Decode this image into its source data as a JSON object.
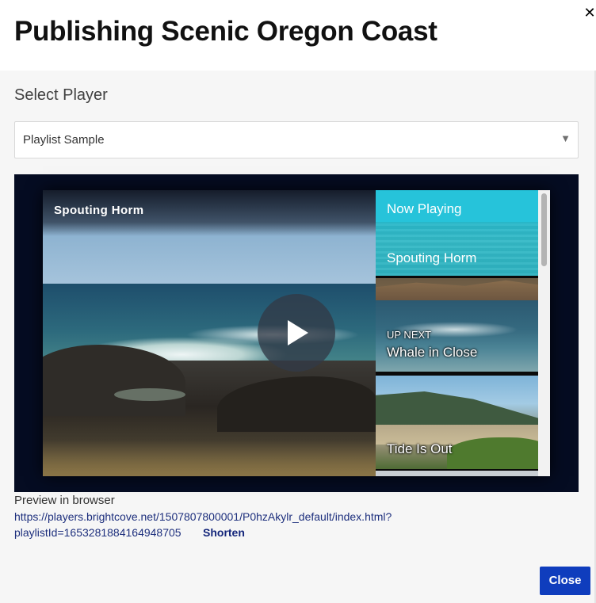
{
  "dialog": {
    "title": "Publishing Scenic Oregon Coast",
    "close_symbol": "✕"
  },
  "player_select": {
    "label": "Select Player",
    "selected": "Playlist Sample",
    "caret": "▼"
  },
  "video": {
    "title": "Spouting Horm",
    "play_icon": "play-icon"
  },
  "playlist": {
    "now_playing_label": "Now Playing",
    "now_playing_title": "Spouting Horm",
    "up_next_label": "UP NEXT",
    "up_next_title": "Whale in Close",
    "third_title": "Tide Is Out"
  },
  "preview": {
    "label": "Preview in browser",
    "url_line1": "https://players.brightcove.net/1507807800001/P0hzAkylr_default/index.html?",
    "url_line2": "playlistId=1653281884164948705",
    "shorten_label": "Shorten"
  },
  "footer": {
    "close_label": "Close"
  },
  "colors": {
    "accent": "#0f3dbd",
    "link": "#1d2f7d",
    "now_playing_bg": "#26c3da",
    "preview_bg": "#050c22"
  }
}
